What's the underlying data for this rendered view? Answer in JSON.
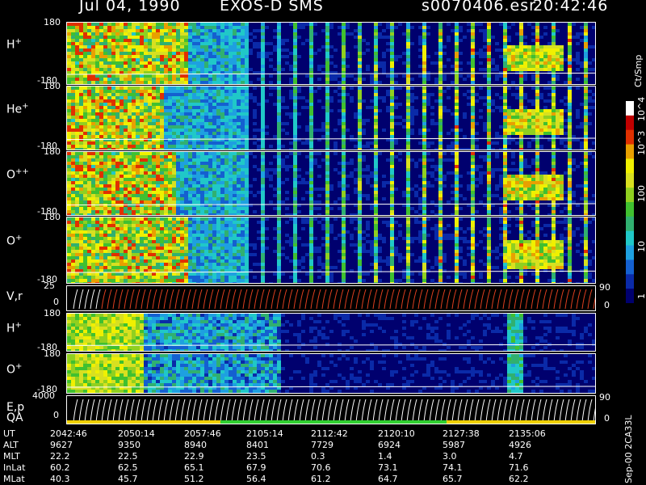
{
  "header": {
    "date": "Jul 04, 1990",
    "instrument": "EXOS-D SMS",
    "file": "s0070406.esr",
    "time": "20:42:46"
  },
  "colorbar": {
    "unit": "Ct/Smp",
    "ticks": [
      "10^4",
      "10^3",
      "100",
      "10",
      "1"
    ]
  },
  "chart_data": {
    "type": "heatmap",
    "panels": [
      {
        "label": "H",
        "charge": "+",
        "ymin": "-180",
        "ymax": "180"
      },
      {
        "label": "He",
        "charge": "+",
        "ymin": "-180",
        "ymax": "180"
      },
      {
        "label": "O",
        "charge": "++",
        "ymin": "-180",
        "ymax": "180"
      },
      {
        "label": "O",
        "charge": "+",
        "ymin": "-180",
        "ymax": "180"
      },
      {
        "label": "V,r",
        "charge": "",
        "ymin": "0",
        "ymax": "25",
        "right_top": "90",
        "right_bottom": "0"
      },
      {
        "label": "H",
        "charge": "+",
        "ymin": "-180",
        "ymax": "180"
      },
      {
        "label": "O",
        "charge": "+",
        "ymin": "-180",
        "ymax": "180"
      },
      {
        "label": "E,p",
        "label2": "QA",
        "charge": "",
        "ymin": "0",
        "ymax": "4000",
        "right_top": "90",
        "right_bottom": "0"
      }
    ],
    "table": {
      "row_labels": [
        "UT",
        "ALT",
        "MLT",
        "InLat",
        "MLat"
      ],
      "columns": [
        {
          "UT": "2042:46",
          "ALT": "9627",
          "MLT": "22.2",
          "InLat": "60.2",
          "MLat": "40.3"
        },
        {
          "UT": "2050:14",
          "ALT": "9350",
          "MLT": "22.5",
          "InLat": "62.5",
          "MLat": "45.7"
        },
        {
          "UT": "2057:46",
          "ALT": "8940",
          "MLT": "22.9",
          "InLat": "65.1",
          "MLat": "51.2"
        },
        {
          "UT": "2105:14",
          "ALT": "8401",
          "MLT": "23.5",
          "InLat": "67.9",
          "MLat": "56.4"
        },
        {
          "UT": "2112:42",
          "ALT": "7729",
          "MLT": "0.3",
          "InLat": "70.6",
          "MLat": "61.2"
        },
        {
          "UT": "2120:10",
          "ALT": "6924",
          "MLT": "1.4",
          "InLat": "73.1",
          "MLat": "64.7"
        },
        {
          "UT": "2127:38",
          "ALT": "5987",
          "MLT": "3.0",
          "InLat": "74.1",
          "MLat": "65.7"
        },
        {
          "UT": "2135:06",
          "ALT": "4926",
          "MLT": "4.7",
          "InLat": "71.6",
          "MLat": "62.2"
        }
      ]
    }
  },
  "side_label": "Sep-00 2CA33L"
}
